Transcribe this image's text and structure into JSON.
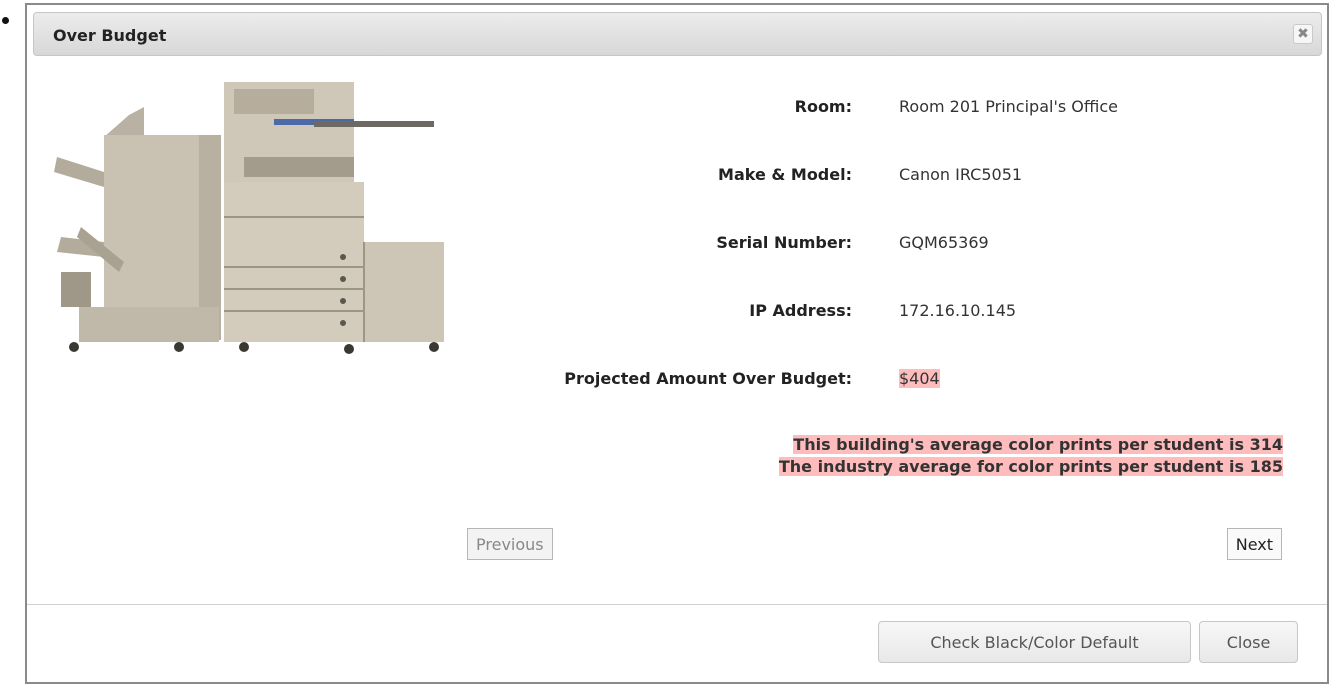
{
  "dialog": {
    "title": "Over Budget",
    "close_icon": "close-icon"
  },
  "printer_image": "printer-image",
  "details": {
    "room_label": "Room:",
    "room_value": "Room 201 Principal's Office",
    "model_label": "Make & Model:",
    "model_value": "Canon IRC5051",
    "serial_label": "Serial Number:",
    "serial_value": "GQM65369",
    "ip_label": "IP Address:",
    "ip_value": "172.16.10.145",
    "over_label": "Projected Amount Over Budget:",
    "over_value": "$404"
  },
  "notes": {
    "building_avg": "This building's average color prints per student is 314",
    "industry_avg": "The industry average for color prints per student is 185"
  },
  "nav": {
    "previous": "Previous",
    "next": "Next"
  },
  "footer": {
    "check_default": "Check Black/Color Default",
    "close": "Close"
  },
  "colors": {
    "highlight": "#ffbcbc",
    "titlebar": "#e2e2e2"
  }
}
